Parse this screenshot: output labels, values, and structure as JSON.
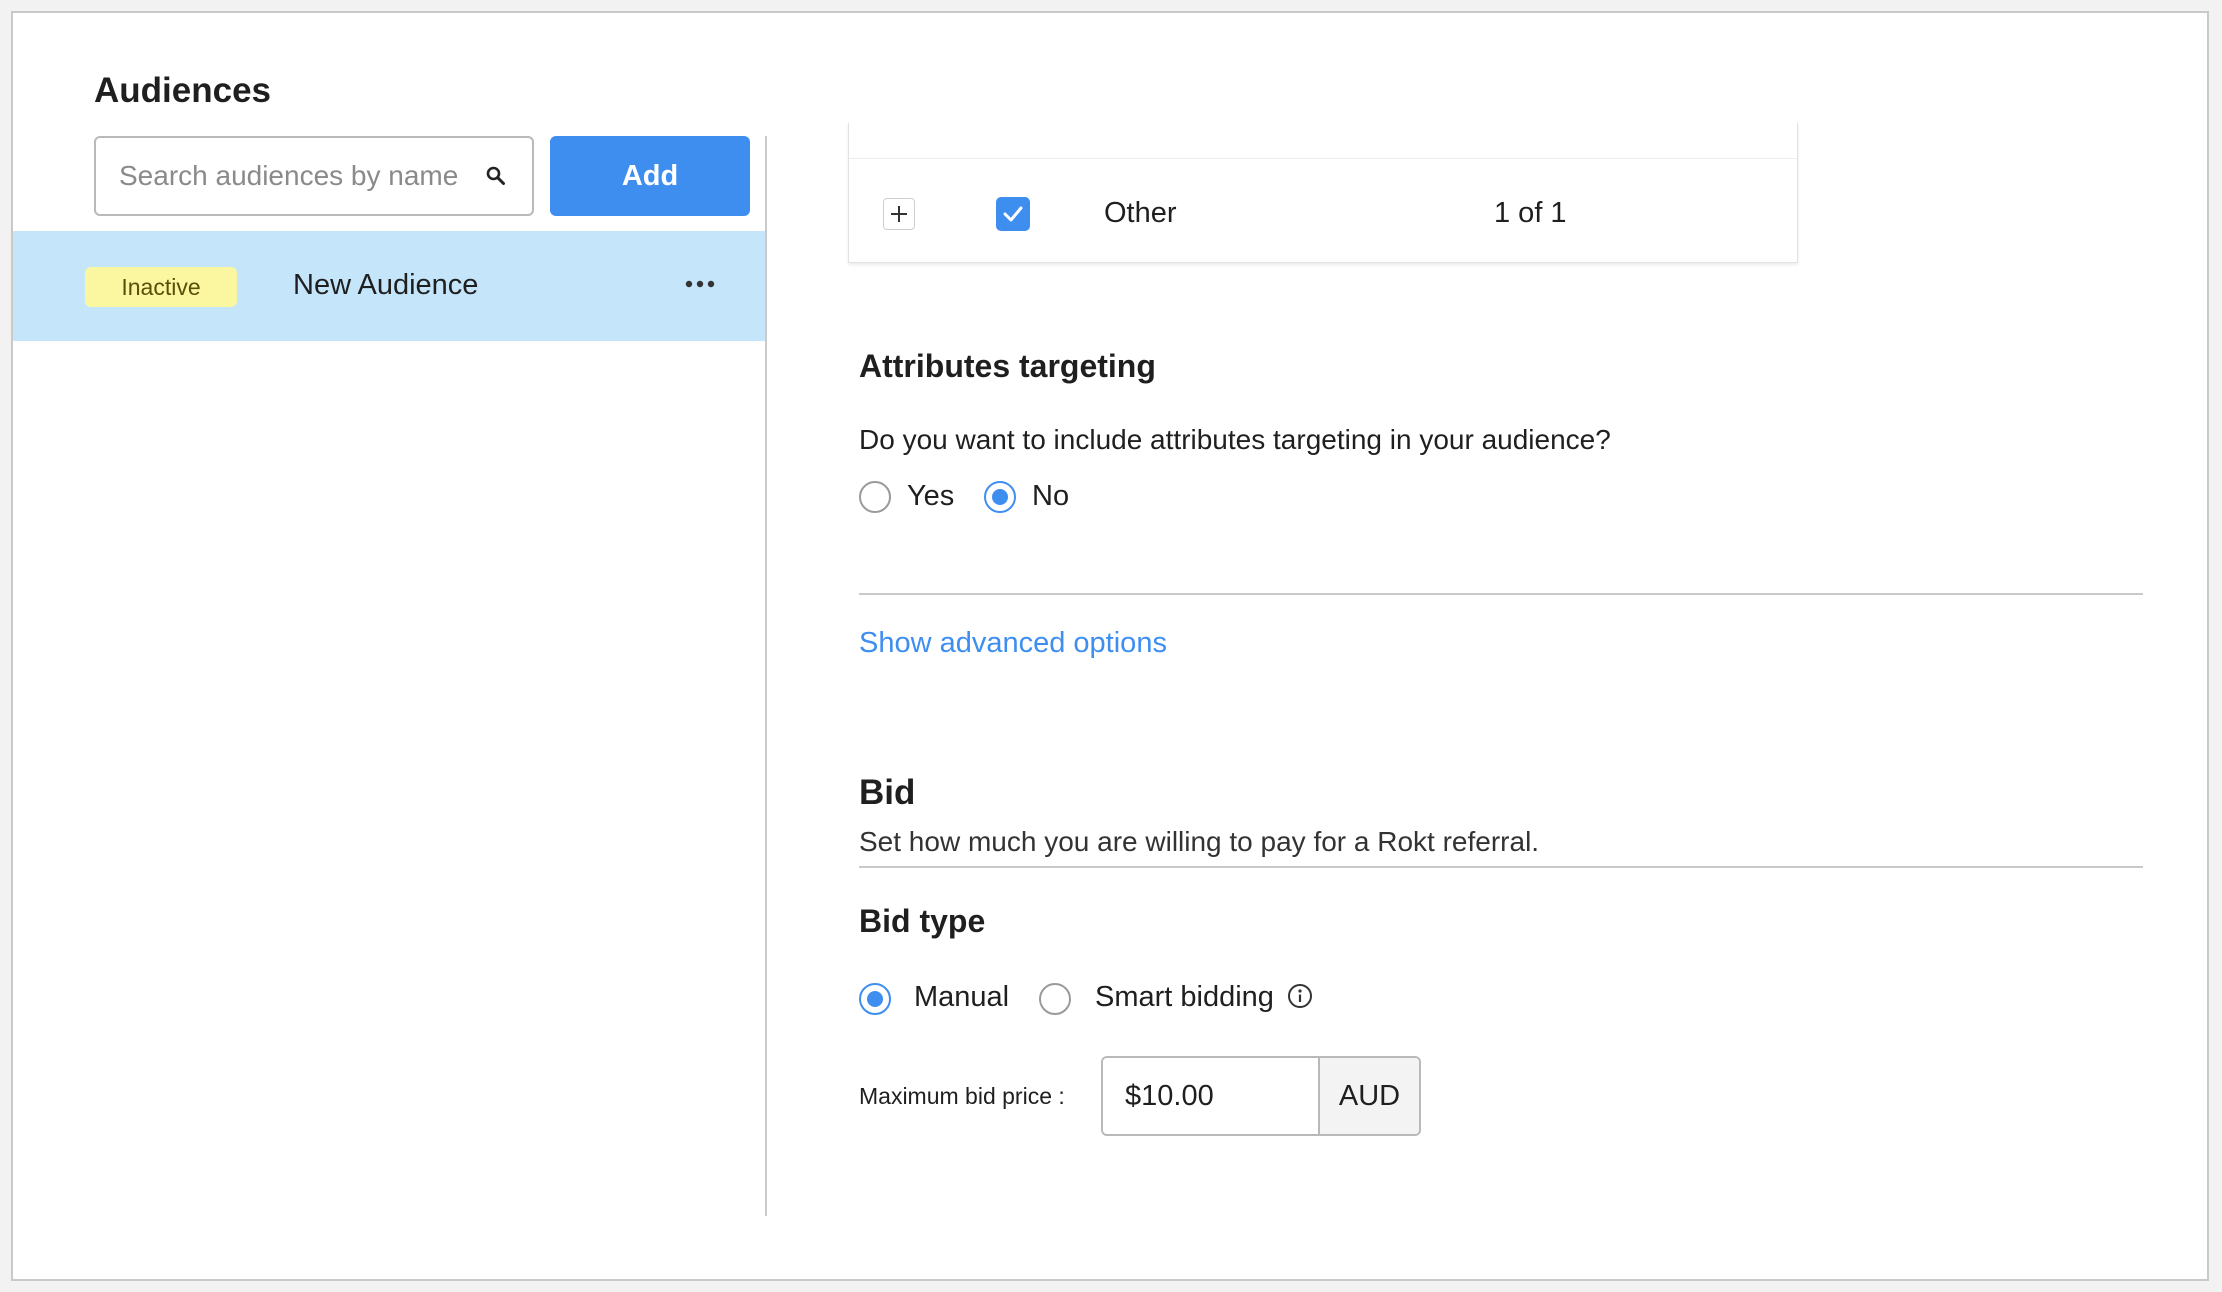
{
  "sidebar": {
    "title": "Audiences",
    "search_placeholder": "Search audiences by name",
    "add_label": "Add",
    "audiences": [
      {
        "status": "Inactive",
        "name": "New Audience"
      }
    ]
  },
  "location_table": {
    "row_label": "Other",
    "row_count": "1 of 1",
    "checked": true
  },
  "attributes": {
    "title": "Attributes targeting",
    "question": "Do you want to include attributes targeting in your audience?",
    "options": [
      "Yes",
      "No"
    ],
    "selected": "No"
  },
  "advanced_link": "Show advanced options",
  "bid": {
    "title": "Bid",
    "subtitle": "Set how much you are willing to pay for a Rokt referral.",
    "type_title": "Bid type",
    "options": [
      "Manual",
      "Smart bidding"
    ],
    "selected": "Manual",
    "max_label": "Maximum bid price :",
    "max_value": "$10.00",
    "currency": "AUD"
  },
  "colors": {
    "accent": "#3e8ef0",
    "selected_row": "#c5e5fb",
    "inactive_badge": "#fbf7a1"
  }
}
